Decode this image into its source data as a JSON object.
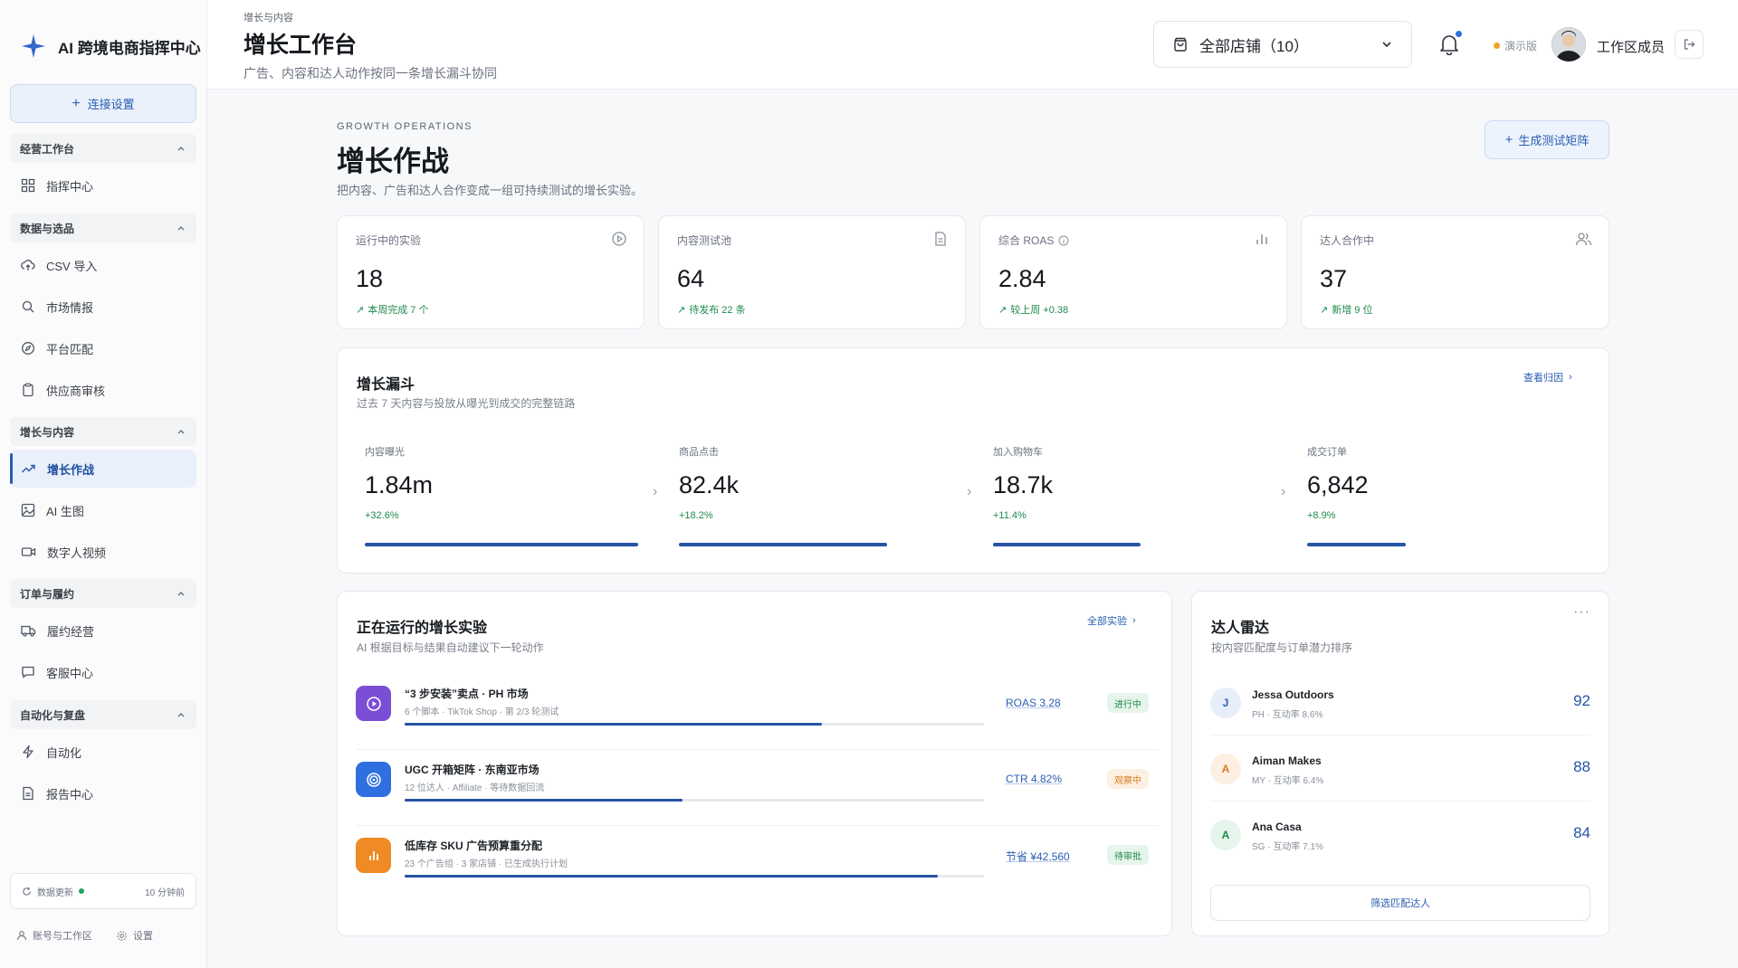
{
  "sidebar": {
    "brand": "AI 跨境电商指挥中心",
    "connect_label": "连接设置",
    "sections": [
      {
        "label": "经营工作台",
        "items": [
          {
            "label": "指挥中心",
            "icon": "grid-icon"
          }
        ]
      },
      {
        "label": "数据与选品",
        "items": [
          {
            "label": "CSV 导入",
            "icon": "upload-cloud-icon"
          },
          {
            "label": "市场情报",
            "icon": "search-icon"
          },
          {
            "label": "平台匹配",
            "icon": "compass-icon"
          },
          {
            "label": "供应商审核",
            "icon": "clipboard-icon"
          }
        ]
      },
      {
        "label": "增长与内容",
        "items": [
          {
            "label": "增长作战",
            "icon": "trending-up-icon",
            "active": true
          },
          {
            "label": "AI 生图",
            "icon": "image-icon"
          },
          {
            "label": "数字人视频",
            "icon": "video-icon"
          }
        ]
      },
      {
        "label": "订单与履约",
        "items": [
          {
            "label": "履约经营",
            "icon": "truck-icon"
          },
          {
            "label": "客服中心",
            "icon": "message-icon"
          }
        ]
      },
      {
        "label": "自动化与复盘",
        "items": [
          {
            "label": "自动化",
            "icon": "zap-icon"
          },
          {
            "label": "报告中心",
            "icon": "file-icon"
          }
        ]
      }
    ],
    "status": {
      "label": "数据更新",
      "time": "10 分钟前"
    },
    "footer": {
      "account": "账号与工作区",
      "settings": "设置"
    }
  },
  "header": {
    "breadcrumb": "增长与内容",
    "title": "增长工作台",
    "subtitle": "广告、内容和达人动作按同一条增长漏斗协同",
    "store_select": "全部店铺（10）",
    "demo_label": "演示版",
    "user_name": "工作区成员"
  },
  "main": {
    "eyebrow": "GROWTH OPERATIONS",
    "title": "增长作战",
    "subtitle": "把内容、广告和达人合作变成一组可持续测试的增长实验。",
    "generate_label": "生成测试矩阵"
  },
  "stats": [
    {
      "label": "运行中的实验",
      "value": "18",
      "delta": "本周完成 7 个",
      "icon": "play-circle-icon"
    },
    {
      "label": "内容测试池",
      "value": "64",
      "delta": "待发布 22 条",
      "icon": "document-icon"
    },
    {
      "label": "综合 ROAS",
      "value": "2.84",
      "delta": "较上周 +0.38",
      "icon": "bar-chart-icon"
    },
    {
      "label": "达人合作中",
      "value": "37",
      "delta": "新增 9 位",
      "icon": "users-icon"
    }
  ],
  "funnel": {
    "title": "增长漏斗",
    "subtitle": "过去 7 天内容与投放从曝光到成交的完整链路",
    "link": "查看归因",
    "steps": [
      {
        "label": "内容曝光",
        "value": "1.84m",
        "delta": "+32.6%",
        "level": 1.0
      },
      {
        "label": "商品点击",
        "value": "82.4k",
        "delta": "+18.2%",
        "level": 0.76
      },
      {
        "label": "加入购物车",
        "value": "18.7k",
        "delta": "+11.4%",
        "level": 0.54
      },
      {
        "label": "成交订单",
        "value": "6,842",
        "delta": "+8.9%",
        "level": 0.36
      }
    ]
  },
  "experiments": {
    "title": "正在运行的增长实验",
    "subtitle": "AI 根据目标与结果自动建议下一轮动作",
    "link": "全部实验",
    "rows": [
      {
        "title": "“3 步安装”卖点 · PH 市场",
        "meta": "6 个脚本 · TikTok Shop · 第 2/3 轮测试",
        "metric": "ROAS 3.28",
        "badge": "进行中",
        "progress": 0.72,
        "color": "#7a4fd6",
        "badge_bg": "#e6f5ec",
        "badge_fg": "#1f8a4c",
        "icon": "play-icon"
      },
      {
        "title": "UGC 开箱矩阵 · 东南亚市场",
        "meta": "12 位达人 · Affiliate · 等待数据回流",
        "metric": "CTR 4.82%",
        "badge": "观察中",
        "progress": 0.48,
        "color": "#2f6fe0",
        "badge_bg": "#fdf0e2",
        "badge_fg": "#d97a1e",
        "icon": "target-icon"
      },
      {
        "title": "低库存 SKU 广告预算重分配",
        "meta": "23 个广告组 · 3 家店铺 · 已生成执行计划",
        "metric": "节省 ¥42,560",
        "badge": "待审批",
        "progress": 0.92,
        "color": "#f08a24",
        "badge_bg": "#e6f5ec",
        "badge_fg": "#1f8a4c",
        "icon": "bar-chart-icon"
      }
    ]
  },
  "radar": {
    "title": "达人雷达",
    "subtitle": "按内容匹配度与订单潜力排序",
    "button": "筛选匹配达人",
    "rows": [
      {
        "initial": "J",
        "name": "Jessa Outdoors",
        "meta": "PH · 互动率 8.6%",
        "score": "92",
        "bg": "#e8eef9",
        "fg": "#2a5db0"
      },
      {
        "initial": "A",
        "name": "Aiman Makes",
        "meta": "MY · 互动率 6.4%",
        "score": "88",
        "bg": "#fdf0e2",
        "fg": "#d97a1e"
      },
      {
        "initial": "A",
        "name": "Ana Casa",
        "meta": "SG · 互动率 7.1%",
        "score": "84",
        "bg": "#e6f5ec",
        "fg": "#1f8a4c"
      }
    ]
  }
}
